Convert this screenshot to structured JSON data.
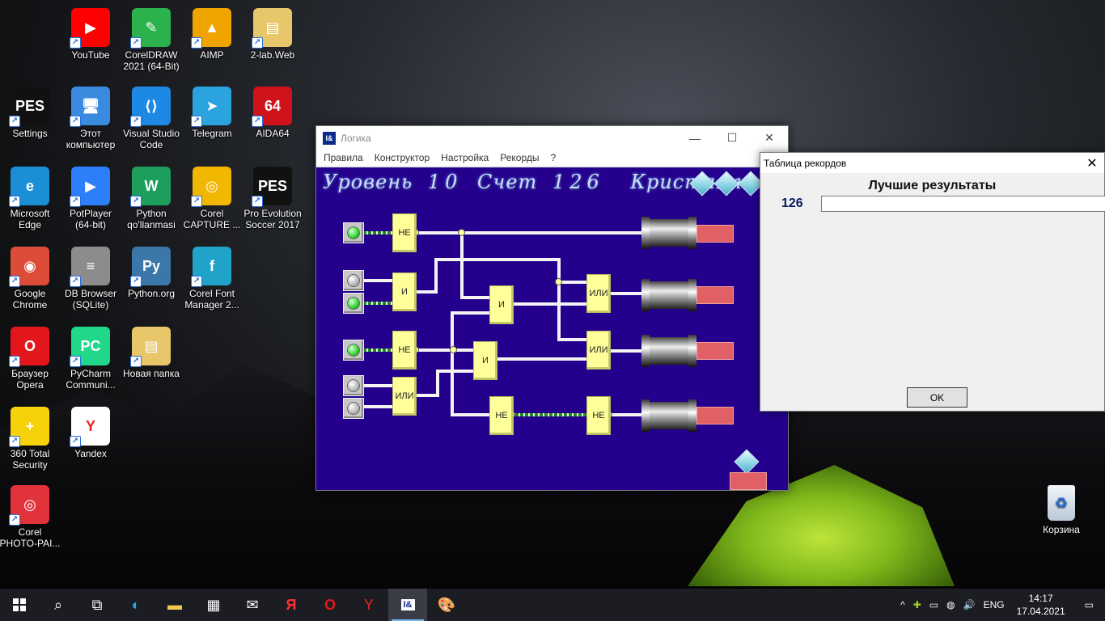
{
  "desktop": {
    "icons": [
      {
        "label": "YouTube",
        "color": "#ff0000",
        "glyph": "▶"
      },
      {
        "label": "CorelDRAW 2021 (64-Bit)",
        "color": "#2bb24c",
        "glyph": "✎"
      },
      {
        "label": "AIMP",
        "color": "#f0a400",
        "glyph": "▲"
      },
      {
        "label": "2-lab.Web",
        "color": "#e8c66a",
        "glyph": "▤"
      },
      {
        "label": "Settings",
        "color": "#111111",
        "glyph": "PES"
      },
      {
        "label": "Этот компьютер",
        "color": "#3a8be0",
        "glyph": "🖥"
      },
      {
        "label": "Visual Studio Code",
        "color": "#1e88e5",
        "glyph": "⟨⟩"
      },
      {
        "label": "Telegram",
        "color": "#2aa3de",
        "glyph": "➤"
      },
      {
        "label": "AIDA64",
        "color": "#d0121a",
        "glyph": "64"
      },
      {
        "label": "Microsoft Edge",
        "color": "#1a8fd6",
        "glyph": "e"
      },
      {
        "label": "PotPlayer (64-bit)",
        "color": "#2d7ff9",
        "glyph": "▶"
      },
      {
        "label": "Python qo'llanmasi",
        "color": "#1d9e5c",
        "glyph": "W"
      },
      {
        "label": "Corel CAPTURE ...",
        "color": "#f2b700",
        "glyph": "◎"
      },
      {
        "label": "Pro Evolution Soccer 2017",
        "color": "#111111",
        "glyph": "PES"
      },
      {
        "label": "Google Chrome",
        "color": "#dd4b39",
        "glyph": "◉"
      },
      {
        "label": "DB Browser (SQLite)",
        "color": "#8c8c8c",
        "glyph": "≡"
      },
      {
        "label": "Python.org",
        "color": "#3b77a8",
        "glyph": "Py"
      },
      {
        "label": "Corel Font Manager 2...",
        "color": "#1fa3c9",
        "glyph": "f"
      },
      {
        "label": "Браузер Opera",
        "color": "#e3161c",
        "glyph": "O"
      },
      {
        "label": "PyCharm Communi...",
        "color": "#21d789",
        "glyph": "PC"
      },
      {
        "label": "Новая папка",
        "color": "#e8c66a",
        "glyph": "▤"
      },
      {
        "label": "360 Total Security",
        "color": "#f5d20a",
        "glyph": "+"
      },
      {
        "label": "Yandex",
        "color": "#ffffff",
        "glyph": "Y"
      },
      {
        "label": "Corel PHOTO-PAI...",
        "color": "#e2333b",
        "glyph": "◎"
      }
    ],
    "recycle_bin": "Корзина"
  },
  "window": {
    "title": "Логика",
    "controls": {
      "minimize": "—",
      "maximize": "☐",
      "close": "✕"
    },
    "menu": [
      "Правила",
      "Конструктор",
      "Настройка",
      "Рекорды",
      "?"
    ]
  },
  "game": {
    "level_label": "Уровень",
    "level": "10",
    "score_label": "Счет",
    "score": "126",
    "crystals_label": "Кристаллы",
    "crystals_count": 3,
    "gates": {
      "g1": "НЕ",
      "g2": "И",
      "g3": "И",
      "g4": "ИЛИ",
      "g5": "НЕ",
      "g6": "И",
      "g7": "ИЛИ",
      "g8": "ИЛИ",
      "g9": "НЕ",
      "g10": "НЕ"
    },
    "switches": [
      true,
      false,
      true,
      true,
      false,
      false
    ]
  },
  "records_dialog": {
    "title": "Таблица рекордов",
    "close": "✕",
    "heading": "Лучшие результаты",
    "score": "126",
    "name_value": "",
    "ok": "OK"
  },
  "taskbar": {
    "language": "ENG",
    "time": "14:17",
    "date": "17.04.2021"
  }
}
